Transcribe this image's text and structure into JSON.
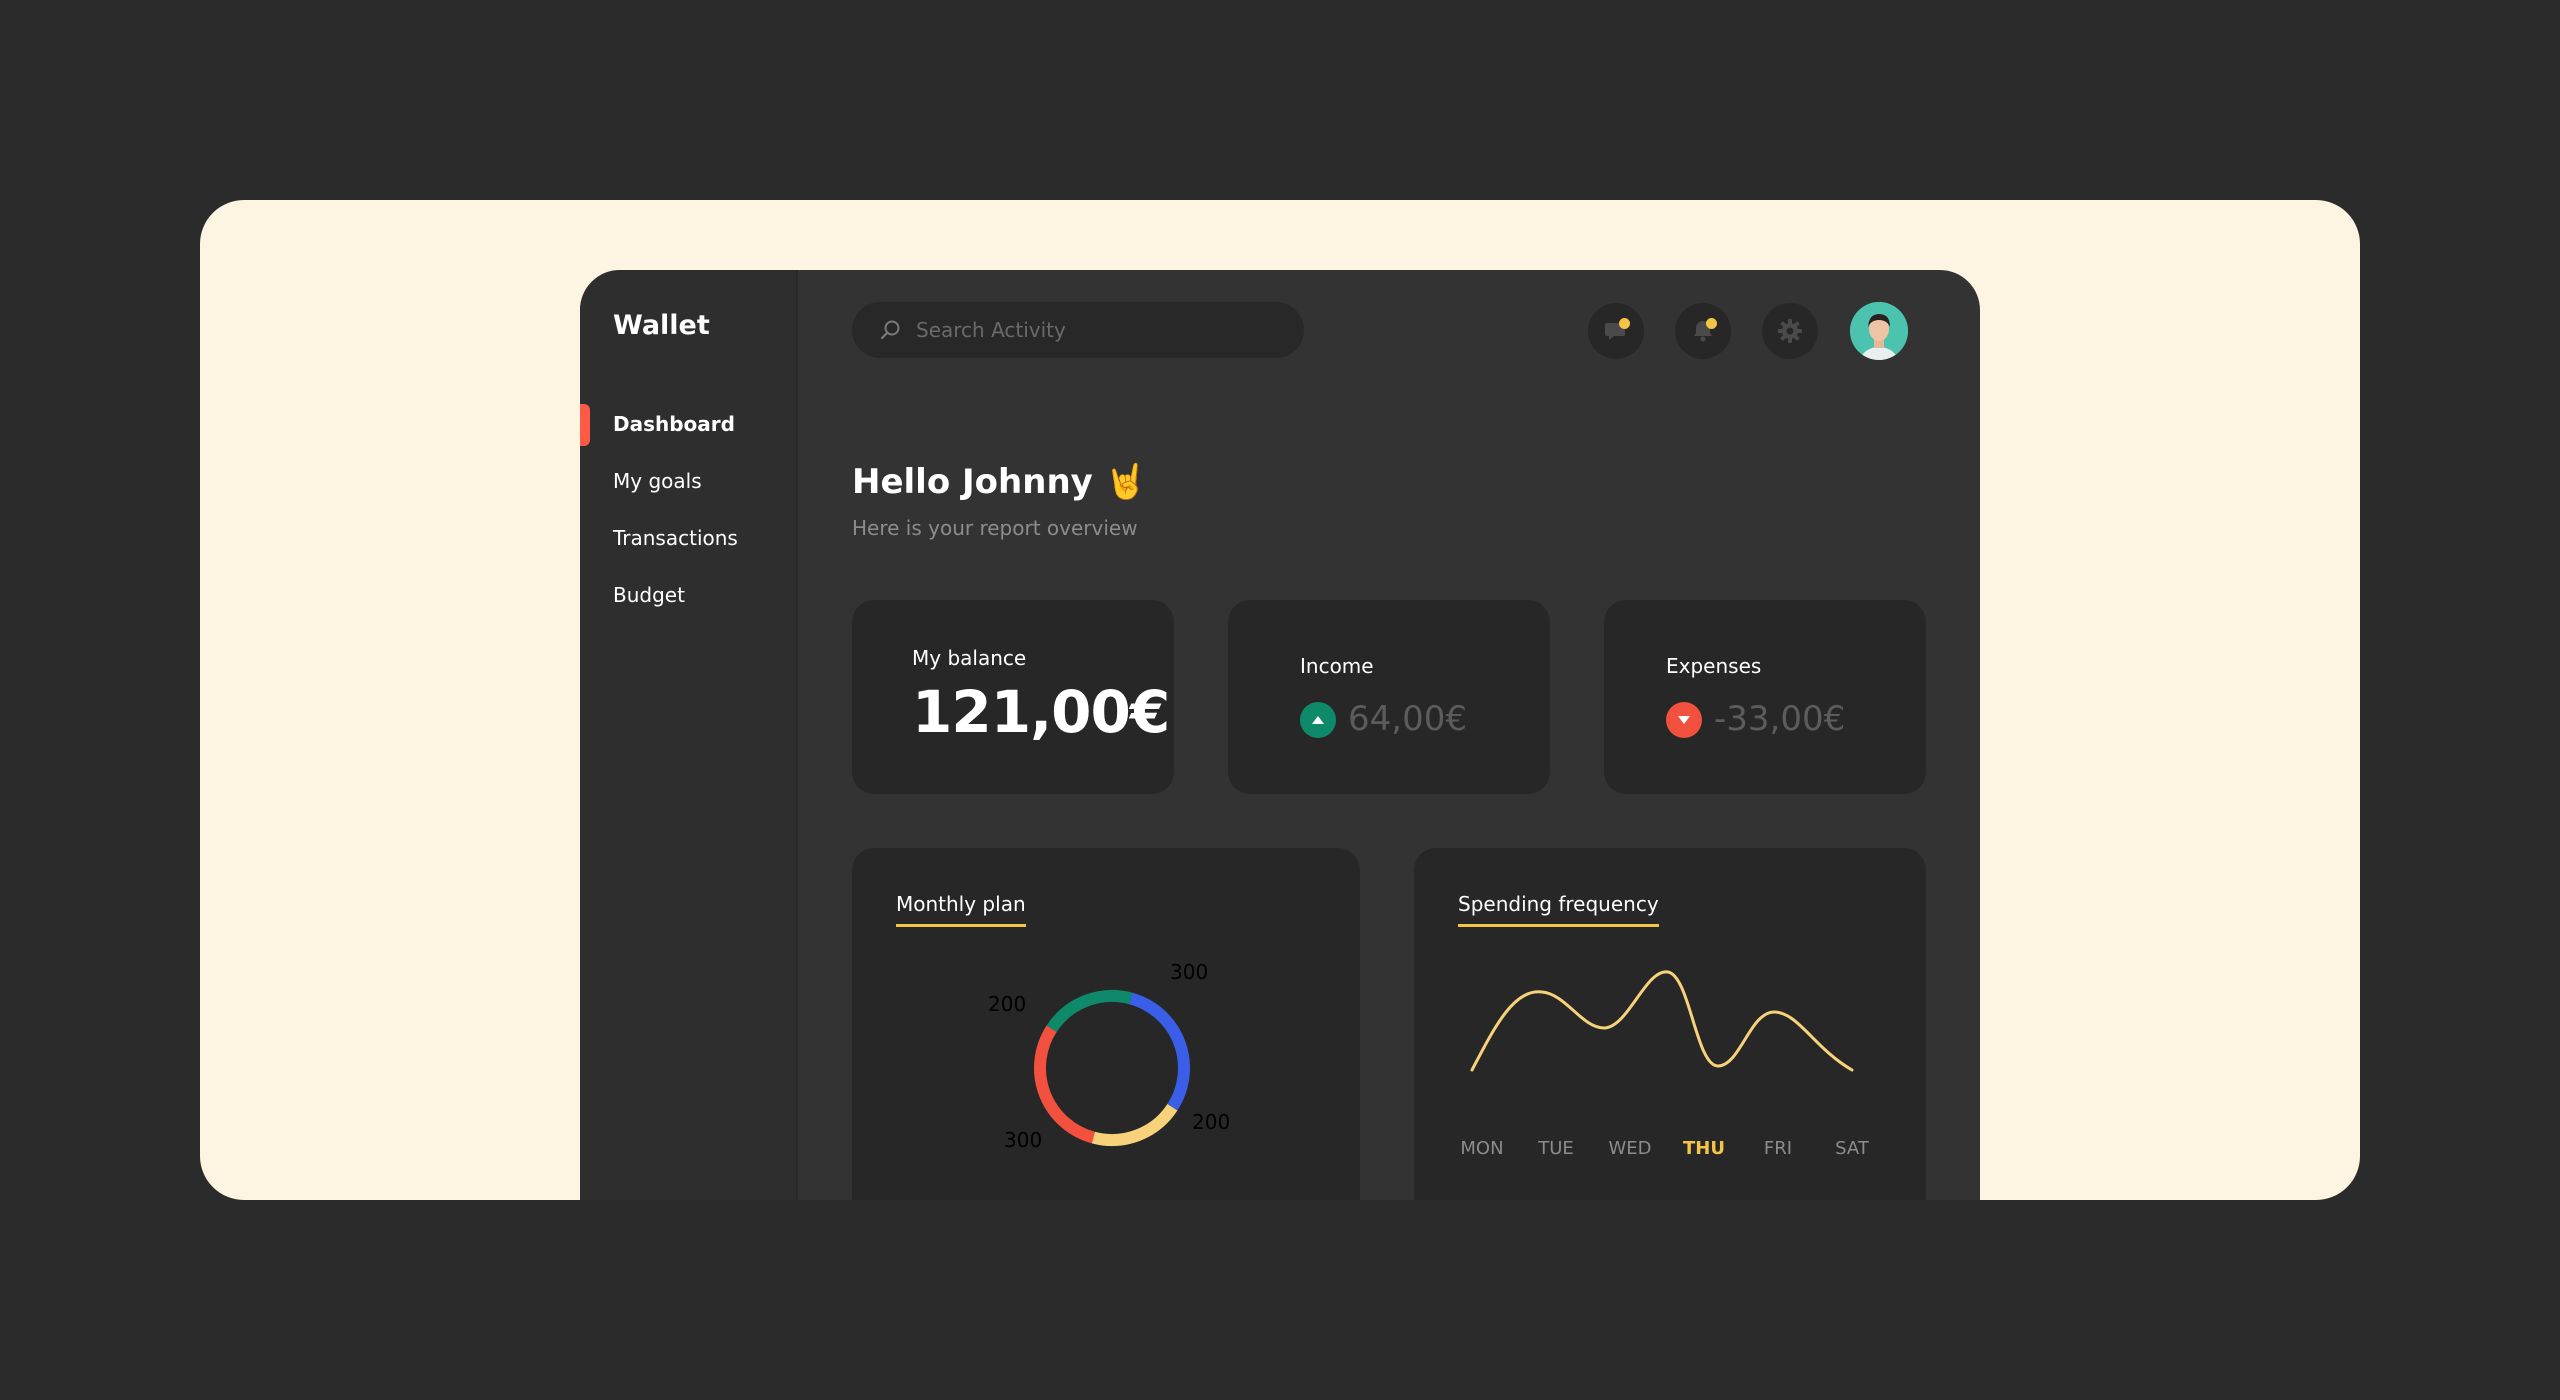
{
  "app": {
    "brand": "Wallet"
  },
  "sidebar": {
    "items": [
      {
        "label": "Dashboard",
        "active": true
      },
      {
        "label": "My goals",
        "active": false
      },
      {
        "label": "Transactions",
        "active": false
      },
      {
        "label": "Budget",
        "active": false
      }
    ]
  },
  "header": {
    "search": {
      "placeholder": "Search Activity",
      "value": ""
    },
    "icons": [
      "messages-icon",
      "bell-icon",
      "gear-icon",
      "avatar"
    ]
  },
  "greeting": {
    "title": "Hello Johnny 🤘",
    "subtitle": "Here is your report overview"
  },
  "cards": {
    "balance": {
      "label": "My balance",
      "value": "121,00€"
    },
    "income": {
      "label": "Income",
      "value": "64,00€",
      "trend": "up"
    },
    "expenses": {
      "label": "Expenses",
      "value": "-33,00€",
      "trend": "down"
    }
  },
  "colors": {
    "accent": "#ff5a45",
    "yellow": "#f5c446",
    "green": "#0e8a6a",
    "blue": "#3b5ee8",
    "red": "#f2513f",
    "light_yellow": "#f7d27a"
  },
  "monthly_plan": {
    "title": "Monthly plan",
    "chart_data": {
      "type": "pie",
      "values": [
        {
          "label": "300",
          "value": 300,
          "color": "#3b5ee8"
        },
        {
          "label": "200",
          "value": 200,
          "color": "#f7d27a"
        },
        {
          "label": "300",
          "value": 300,
          "color": "#f2513f"
        },
        {
          "label": "200",
          "value": 200,
          "color": "#0e8a6a"
        }
      ]
    }
  },
  "spending_frequency": {
    "title": "Spending frequency",
    "active_day": "THU",
    "chart_data": {
      "type": "line",
      "categories": [
        "MON",
        "TUE",
        "WED",
        "THU",
        "FRI",
        "SAT"
      ]
    }
  }
}
